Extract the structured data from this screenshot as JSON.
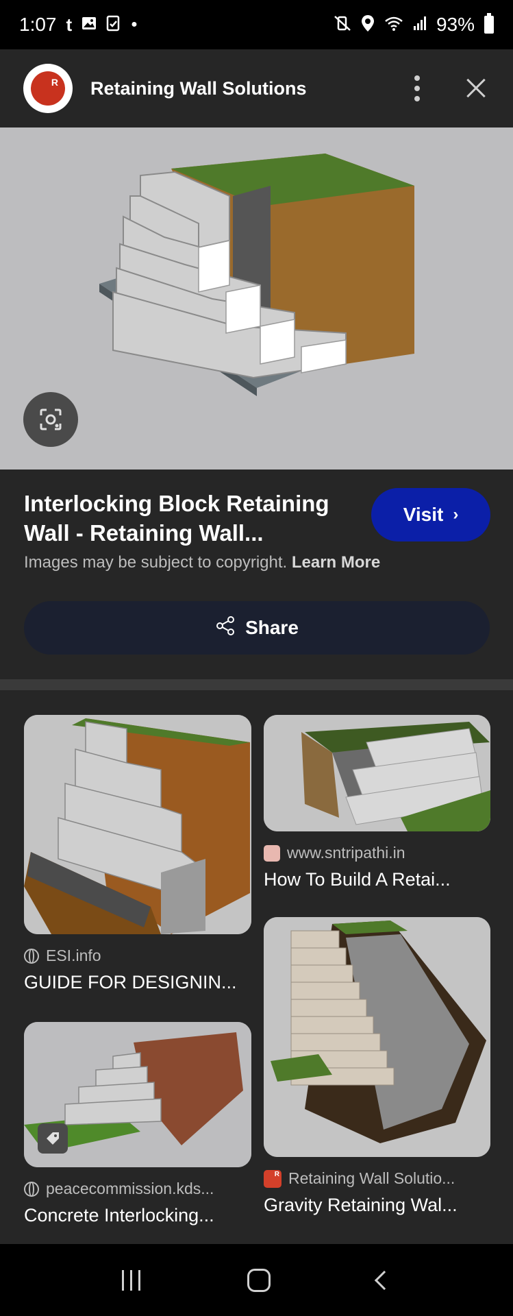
{
  "status_bar": {
    "time": "1:07",
    "left_icons": [
      "tumblr-icon",
      "gallery-icon",
      "clipboard-icon",
      "dot-icon"
    ],
    "right_icons": [
      "mute-vibrate-icon",
      "location-icon",
      "wifi-icon",
      "signal-icon"
    ],
    "battery": "93%"
  },
  "header": {
    "title": "Retaining Wall Solutions"
  },
  "result": {
    "title": "Interlocking Block Retaining Wall - Retaining Wall...",
    "visit_label": "Visit",
    "copyright_text": "Images may be subject to copyright.",
    "learn_more": "Learn More",
    "share_label": "Share"
  },
  "related": [
    {
      "source": "ESI.info",
      "title": "GUIDE FOR DESIGNIN..."
    },
    {
      "source": "www.sntripathi.in",
      "title": "How To Build A Retai..."
    },
    {
      "source": "peacecommission.kds...",
      "title": "Concrete Interlocking..."
    },
    {
      "source": "Retaining Wall Solutio...",
      "title": "Gravity Retaining Wal..."
    }
  ],
  "colors": {
    "accent_visit": "#0b1fa8",
    "share_bg": "#1b2030",
    "panel_bg": "#262626"
  }
}
